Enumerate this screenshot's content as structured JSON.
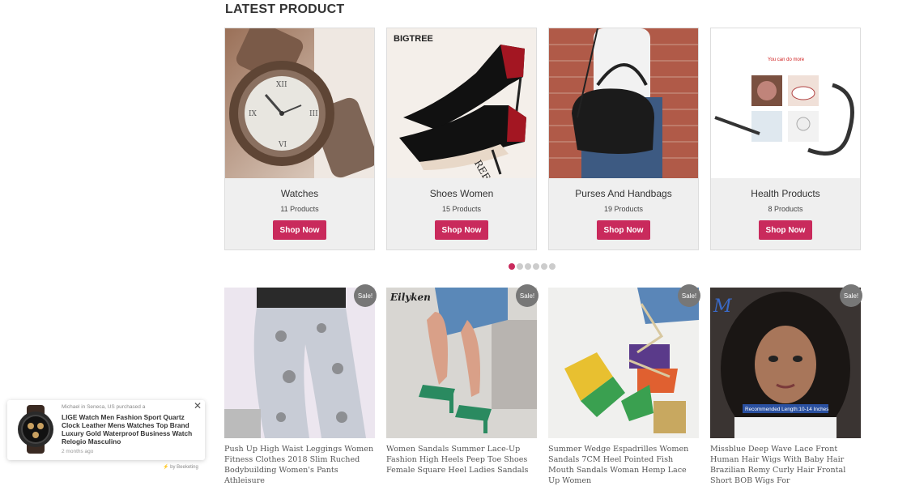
{
  "section": {
    "title": "LATEST PRODUCT"
  },
  "categories": [
    {
      "name": "Watches",
      "count": "11 Products",
      "button": "Shop Now"
    },
    {
      "name": "Shoes Women",
      "count": "15 Products",
      "button": "Shop Now"
    },
    {
      "name": "Purses And Handbags",
      "count": "19 Products",
      "button": "Shop Now"
    },
    {
      "name": "Health Products",
      "count": "8 Products",
      "button": "Shop Now"
    }
  ],
  "category_image_text": {
    "bigtree": "BIGTREE",
    "can_do": "You can do more"
  },
  "carousel": {
    "total": 6,
    "active": 0
  },
  "products": [
    {
      "badge": "Sale!",
      "title": "Push Up High Waist Leggings Women Fitness Clothes 2018 Slim Ruched Bodybuilding Women's Pants Athleisure"
    },
    {
      "badge": "Sale!",
      "title": "Women Sandals Summer Lace-Up Fashion High Heels Peep Toe Shoes Female Square Heel Ladies Sandals",
      "image_text": "Eilyken"
    },
    {
      "badge": "Sale!",
      "title": "Summer Wedge Espadrilles Women Sandals 7CM Heel Pointed Fish Mouth Sandals Woman Hemp Lace Up Women"
    },
    {
      "badge": "Sale!",
      "title": "Missblue Deep Wave Lace Front Human Hair Wigs With Baby Hair Brazilian Remy Curly Hair Frontal Short BOB Wigs For",
      "image_text": "Recommended Length:10-14 Inches"
    }
  ],
  "popup": {
    "who": "Michael in Seneca, US purchased a",
    "title": "LIGE Watch Men Fashion Sport Quartz Clock Leather Mens Watches Top Brand Luxury Gold Waterproof Business Watch Relogio Masculino",
    "ago": "2 months ago",
    "byline": "by Beeketing"
  },
  "colors": {
    "accent": "#c92a5c",
    "badge": "#777777",
    "card_bg": "#efefef"
  }
}
